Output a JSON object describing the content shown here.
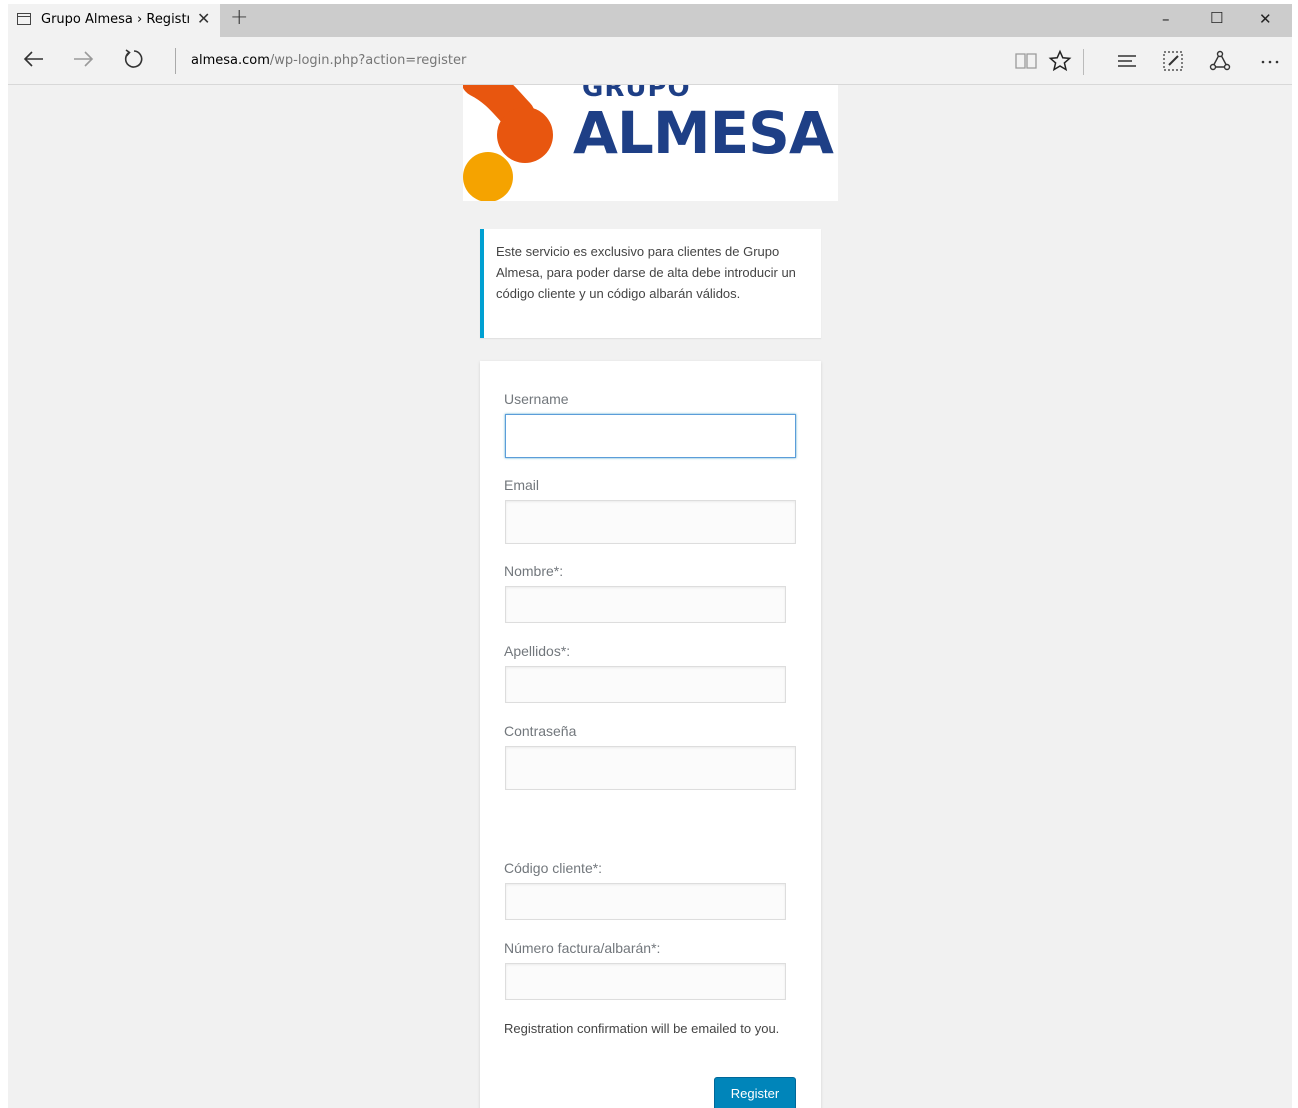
{
  "browser": {
    "tab_title": "Grupo Almesa › Registra",
    "tab_close": "✕",
    "new_tab": "+",
    "url_domain": "almesa.com",
    "url_path": "/wp-login.php?action=register",
    "window_controls": {
      "minimize": "–",
      "maximize": "☐",
      "close": "✕"
    },
    "nav_icons": [
      "back-arrow-icon",
      "forward-arrow-icon",
      "refresh-icon"
    ],
    "tool_icons": [
      "reading-view-icon",
      "favorite-star-icon",
      "hub-icon",
      "web-note-icon",
      "share-icon",
      "more-icon"
    ]
  },
  "logo": {
    "top_text": "GRUPO",
    "main_text": "ALMESA",
    "colors": {
      "brand_blue": "#1e3f86",
      "orange_dark": "#e8560f",
      "orange_light": "#f5a300"
    }
  },
  "notice": {
    "text": "Este servicio es exclusivo para clientes de Grupo Almesa, para poder darse de alta debe introducir un código cliente y un código albarán válidos."
  },
  "form": {
    "username_label": "Username",
    "username_value": "",
    "email_label": "Email",
    "email_value": "",
    "nombre_label": "Nombre*:",
    "nombre_value": "",
    "apellidos_label": "Apellidos*:",
    "apellidos_value": "",
    "password_label": "Contraseña",
    "password_value": "",
    "codigo_label": "Código cliente*:",
    "codigo_value": "",
    "factura_label": "Número factura/albarán*:",
    "factura_value": "",
    "confirmation_text": "Registration confirmation will be emailed to you.",
    "register_label": "Register"
  },
  "colors": {
    "accent": "#00a0d2",
    "button": "#0085ba",
    "focus": "#5b9dd9",
    "background": "#f1f1f1"
  }
}
